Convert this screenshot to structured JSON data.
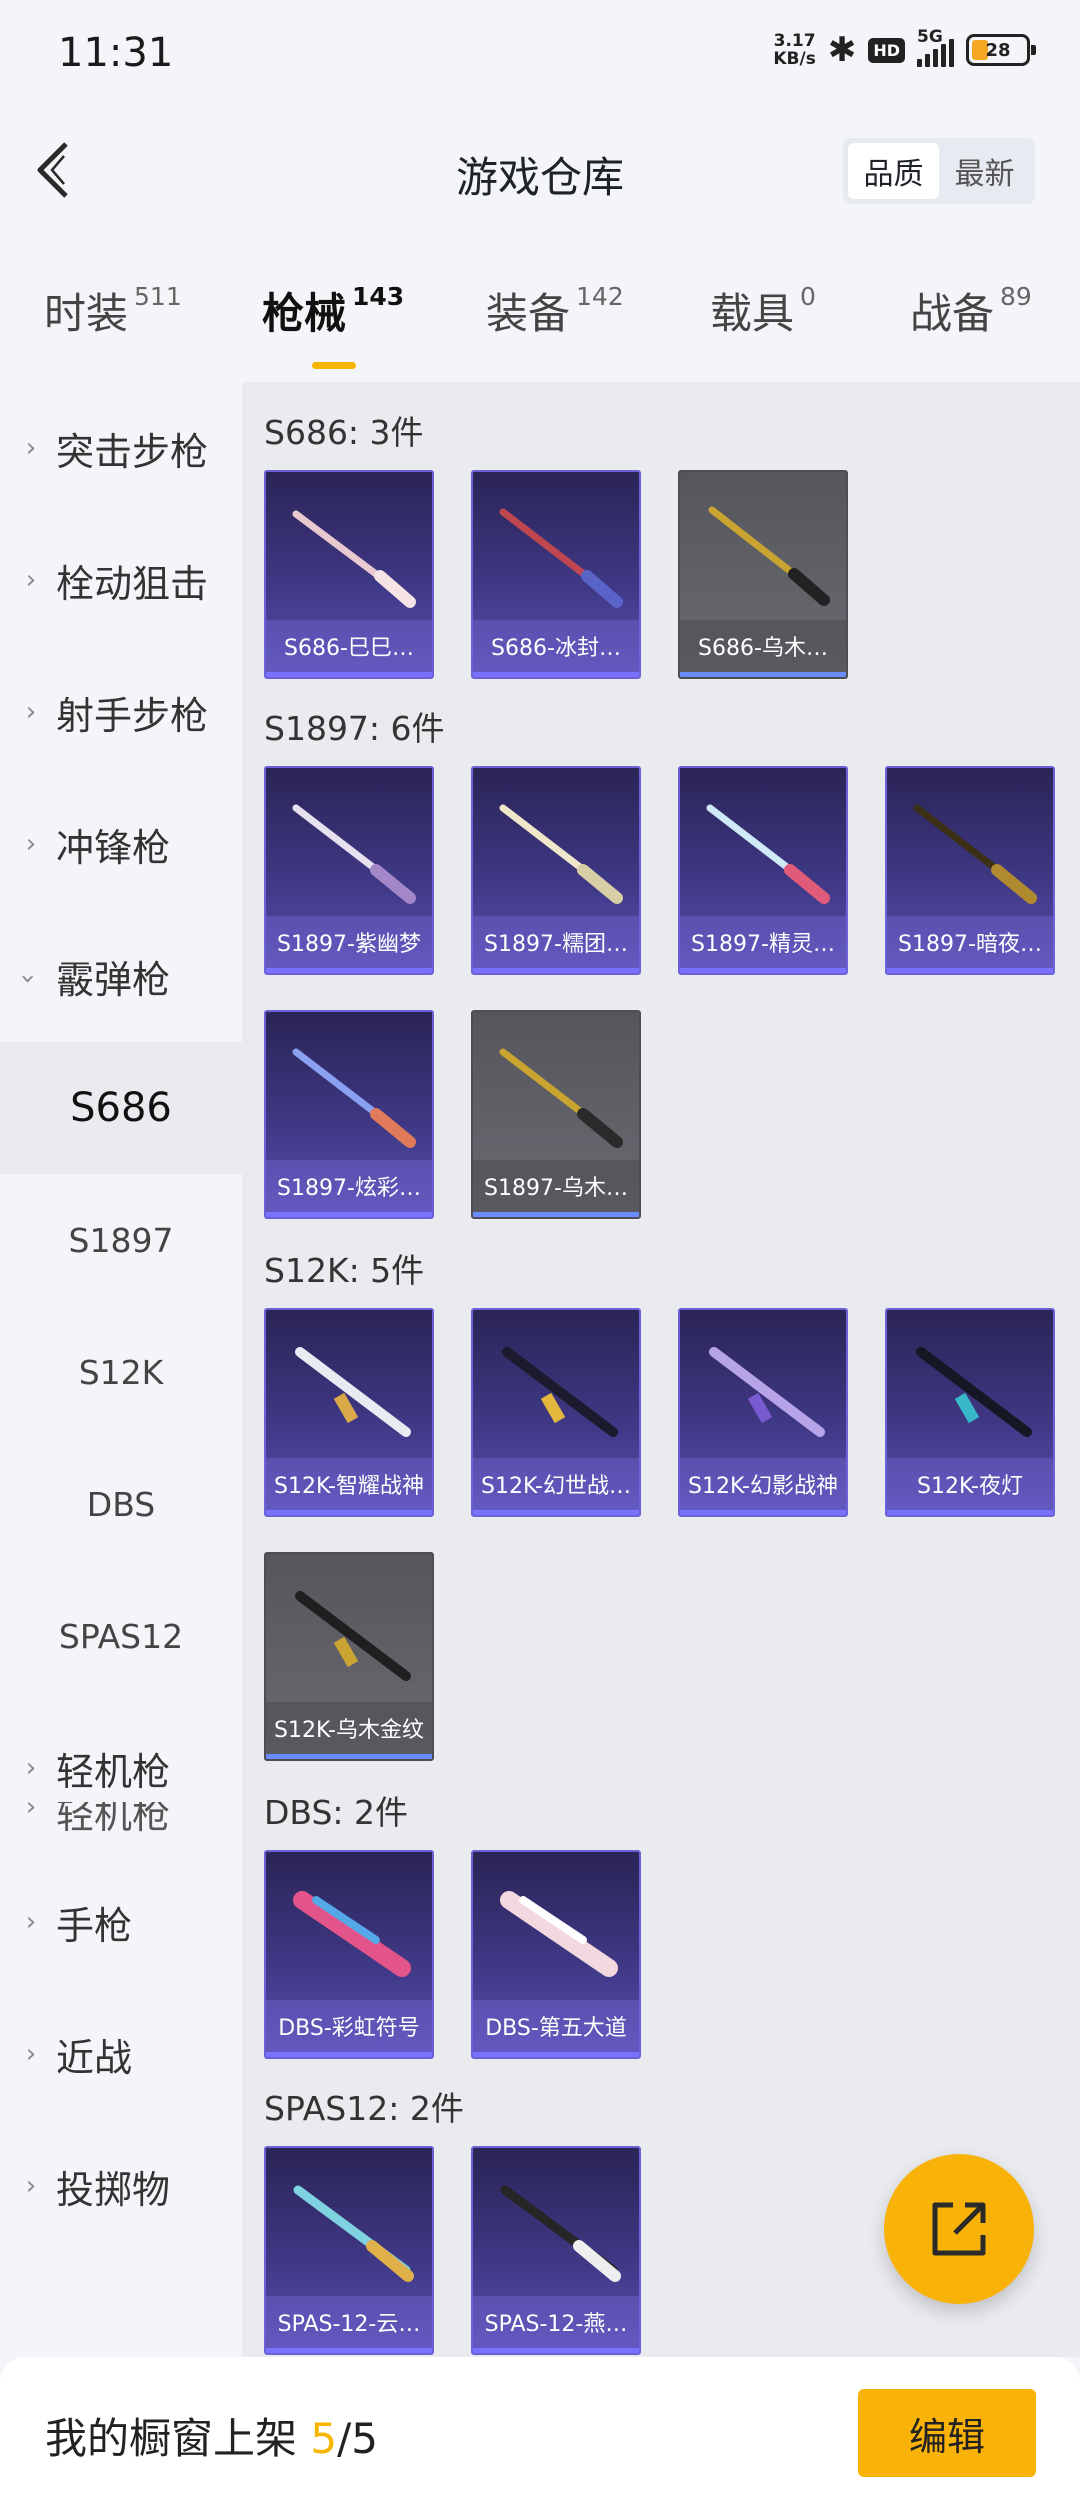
{
  "status": {
    "time": "11:31",
    "net_speed_value": "3.17",
    "net_speed_unit": "KB/s",
    "hd": "HD",
    "network": "5G",
    "battery": "28"
  },
  "header": {
    "title": "游戏仓库",
    "sort": {
      "quality": "品质",
      "newest": "最新"
    }
  },
  "tabs": [
    {
      "label": "时装",
      "count": "511"
    },
    {
      "label": "枪械",
      "count": "143"
    },
    {
      "label": "装备",
      "count": "142"
    },
    {
      "label": "载具",
      "count": "0"
    },
    {
      "label": "战备",
      "count": "89"
    }
  ],
  "sidebar": {
    "categories": [
      "突击步枪",
      "栓动狙击",
      "射手步枪",
      "冲锋枪",
      "霰弹枪"
    ],
    "shotgun_subs": [
      "S686",
      "S1897",
      "S12K",
      "DBS",
      "SPAS12"
    ],
    "more": [
      "轻机枪",
      "轻机枪",
      "手枪",
      "近战",
      "投掷物"
    ]
  },
  "sections": [
    {
      "title": "S686: 3件",
      "items": [
        {
          "name": "S686-巳巳…",
          "quality": "purple"
        },
        {
          "name": "S686-冰封…",
          "quality": "purple"
        },
        {
          "name": "S686-乌木…",
          "quality": "grey"
        }
      ]
    },
    {
      "title": "S1897: 6件",
      "items": [
        {
          "name": "S1897-紫幽梦",
          "quality": "purple"
        },
        {
          "name": "S1897-糯团…",
          "quality": "purple"
        },
        {
          "name": "S1897-精灵…",
          "quality": "purple"
        },
        {
          "name": "S1897-暗夜…",
          "quality": "purple"
        },
        {
          "name": "S1897-炫彩…",
          "quality": "purple"
        },
        {
          "name": "S1897-乌木…",
          "quality": "grey"
        }
      ]
    },
    {
      "title": "S12K: 5件",
      "items": [
        {
          "name": "S12K-智耀战神",
          "quality": "purple"
        },
        {
          "name": "S12K-幻世战…",
          "quality": "purple"
        },
        {
          "name": "S12K-幻影战神",
          "quality": "purple"
        },
        {
          "name": "S12K-夜灯",
          "quality": "purple"
        },
        {
          "name": "S12K-乌木金纹",
          "quality": "grey"
        }
      ]
    },
    {
      "title": "DBS: 2件",
      "items": [
        {
          "name": "DBS-彩虹符号",
          "quality": "purple"
        },
        {
          "name": "DBS-第五大道",
          "quality": "purple"
        }
      ]
    },
    {
      "title": "SPAS12: 2件",
      "items": [
        {
          "name": "SPAS-12-云…",
          "quality": "purple"
        },
        {
          "name": "SPAS-12-燕…",
          "quality": "purple"
        }
      ]
    }
  ],
  "bottom": {
    "prefix": "我的橱窗上架 ",
    "current": "5",
    "sep": "/",
    "total": "5",
    "edit": "编辑"
  },
  "colors": {
    "accent": "#f9b208",
    "card_purple": "#3f3885",
    "card_grey": "#6a6b72"
  }
}
